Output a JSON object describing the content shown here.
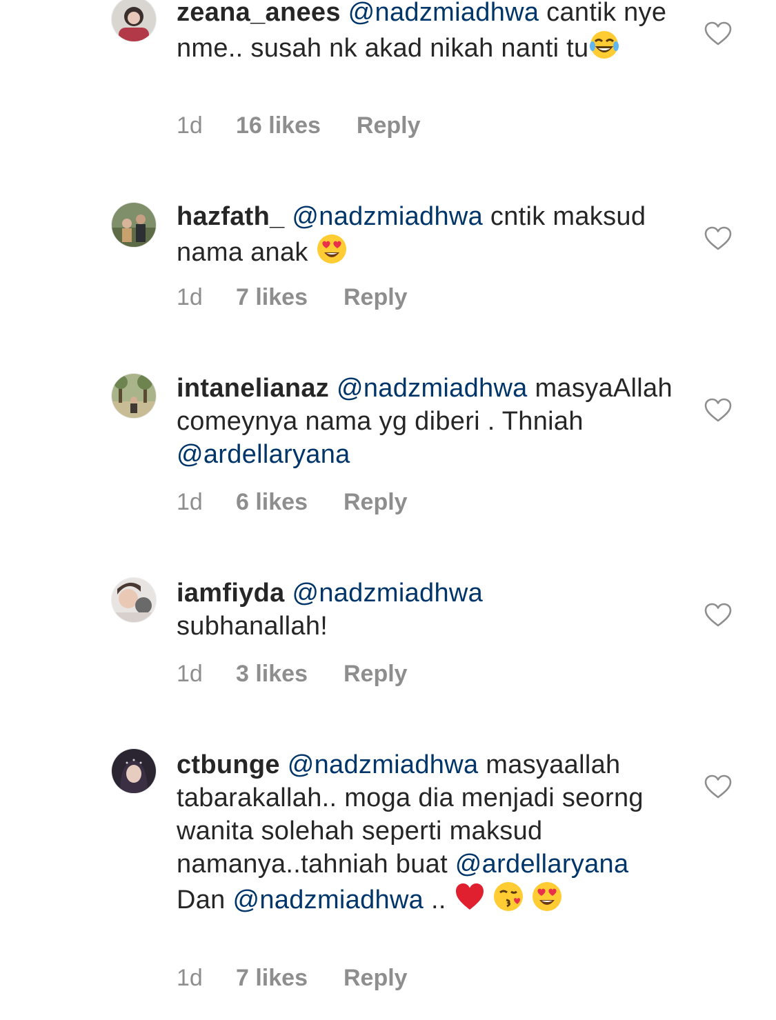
{
  "comments": [
    {
      "username": "zeana_anees",
      "parts": [
        {
          "type": "mention",
          "text": "@nadzmiadhwa"
        },
        {
          "type": "text",
          "text": " cantik nye nme.. susah nk akad nikah nanti tu"
        },
        {
          "type": "emoji",
          "icon": "laughing-tears-emoji"
        }
      ],
      "time": "1d",
      "likes": "16 likes",
      "reply": "Reply"
    },
    {
      "username": "hazfath_",
      "parts": [
        {
          "type": "mention",
          "text": "@nadzmiadhwa"
        },
        {
          "type": "text",
          "text": " cntik maksud nama anak "
        },
        {
          "type": "emoji",
          "icon": "heart-eyes-emoji"
        }
      ],
      "time": "1d",
      "likes": "7 likes",
      "reply": "Reply"
    },
    {
      "username": "intanelianaz",
      "parts": [
        {
          "type": "mention",
          "text": "@nadzmiadhwa"
        },
        {
          "type": "text",
          "text": " masyaAllah comeynya nama yg diberi . Thniah "
        },
        {
          "type": "mention",
          "text": "@ardellaryana"
        }
      ],
      "time": "1d",
      "likes": "6 likes",
      "reply": "Reply"
    },
    {
      "username": "iamfiyda",
      "parts": [
        {
          "type": "mention",
          "text": "@nadzmiadhwa"
        },
        {
          "type": "text",
          "text": " subhanallah!"
        }
      ],
      "time": "1d",
      "likes": "3 likes",
      "reply": "Reply"
    },
    {
      "username": "ctbunge",
      "parts": [
        {
          "type": "mention",
          "text": "@nadzmiadhwa"
        },
        {
          "type": "text",
          "text": " masyaallah tabarakallah.. moga dia menjadi seorng wanita solehah seperti maksud namanya..tahniah buat "
        },
        {
          "type": "mention",
          "text": "@ardellaryana"
        },
        {
          "type": "text",
          "text": "  Dan "
        },
        {
          "type": "mention",
          "text": "@nadzmiadhwa"
        },
        {
          "type": "text",
          "text": " .. "
        },
        {
          "type": "emoji",
          "icon": "red-heart-emoji"
        },
        {
          "type": "emoji",
          "icon": "kissing-face-emoji"
        },
        {
          "type": "emoji",
          "icon": "heart-eyes-emoji"
        }
      ],
      "time": "1d",
      "likes": "7 likes",
      "reply": "Reply"
    }
  ],
  "colors": {
    "text": "#262626",
    "mention": "#003569",
    "meta": "#8e8e8e",
    "background": "#ffffff"
  }
}
